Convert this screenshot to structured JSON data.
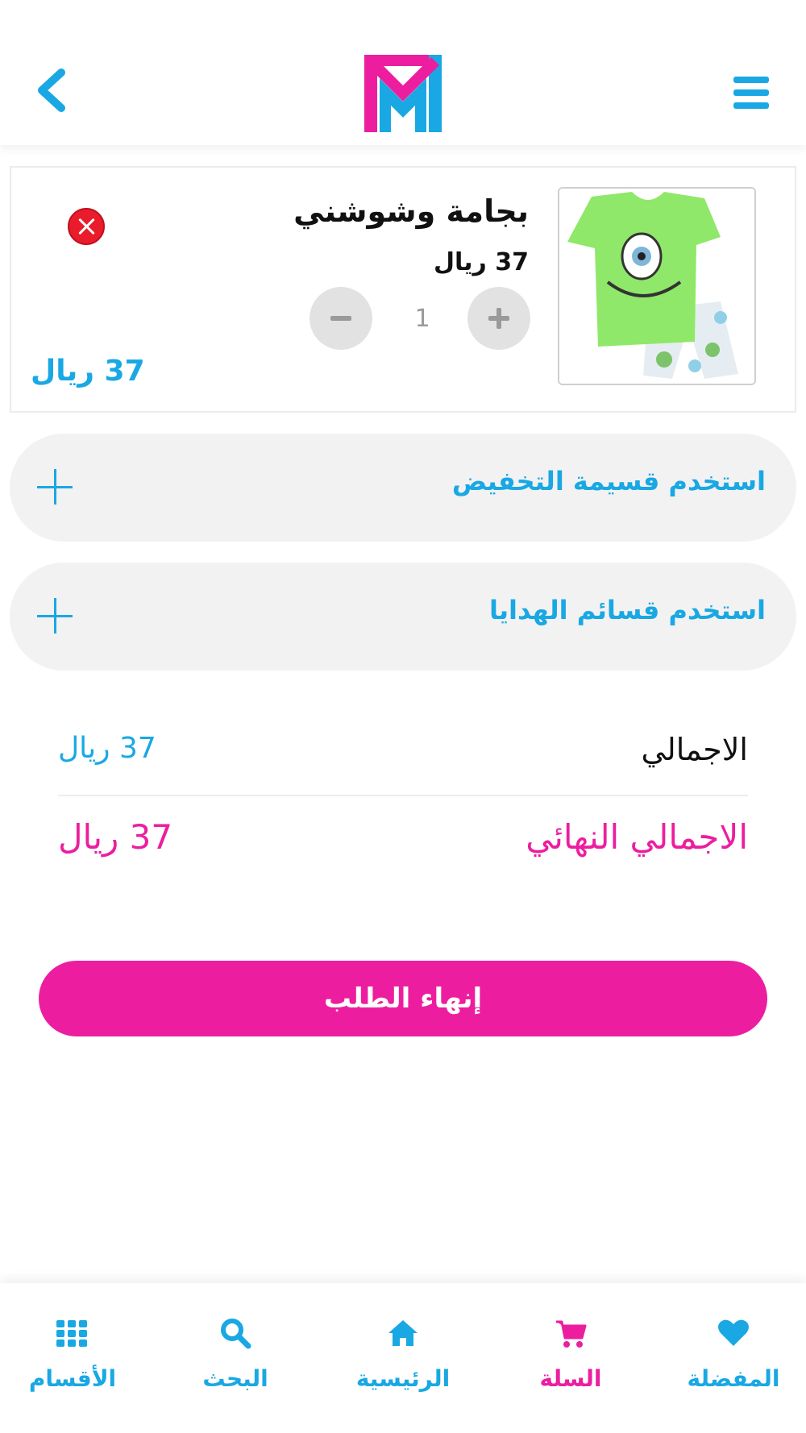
{
  "colors": {
    "accent_blue": "#19a8e3",
    "accent_pink": "#ec1e9f",
    "remove_red": "#ea1c2b",
    "card_gray": "#f2f2f2"
  },
  "header": {
    "menu_icon": "hamburger-icon",
    "logo": "brand-logo",
    "back_icon": "chevron-left-icon"
  },
  "cart_item": {
    "name": "بجامة وشوشني",
    "price": "37 ريال",
    "quantity": "1",
    "total": "37 ريال",
    "image_icon": "pajama-product-image"
  },
  "accordions": {
    "discount": "استخدم قسيمة التخفيض",
    "gifts": "استخدم قسائم الهدايا"
  },
  "summary": {
    "total_label": "الاجمالي",
    "total_value": "37 ريال",
    "final_label": "الاجمالي النهائي",
    "final_value": "37 ريال"
  },
  "checkout": {
    "label": "إنهاء الطلب"
  },
  "bottom_nav": {
    "favorites": "المفضلة",
    "cart": "السلة",
    "home": "الرئيسية",
    "search": "البحث",
    "categories": "الأقسام",
    "active": "cart"
  }
}
